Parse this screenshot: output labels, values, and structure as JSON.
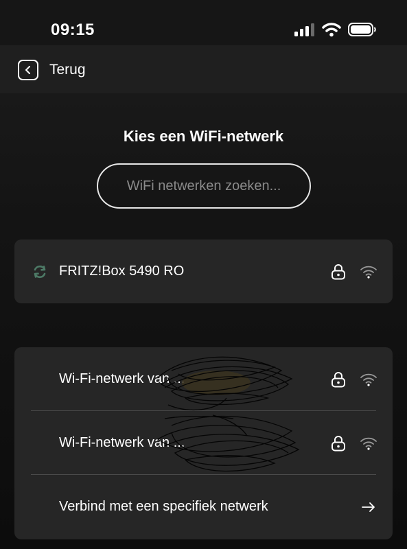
{
  "status_bar": {
    "time": "09:15"
  },
  "nav": {
    "back_label": "Terug"
  },
  "page": {
    "title": "Kies een WiFi-netwerk"
  },
  "search": {
    "placeholder": "WiFi netwerken zoeken..."
  },
  "connected_network": {
    "name": "FRITZ!Box 5490 RO",
    "icon": "refresh-icon",
    "secured": true
  },
  "networks": [
    {
      "name": "Wi-Fi-netwerk van ...",
      "secured": true
    },
    {
      "name": "Wi-Fi-netwerk van ...",
      "secured": true
    }
  ],
  "specific_network": {
    "label": "Verbind met een specifiek netwerk",
    "icon": "arrow-right-icon"
  },
  "colors": {
    "background": "#141414",
    "card": "#262626",
    "accent_refresh": "#4d7a66"
  }
}
